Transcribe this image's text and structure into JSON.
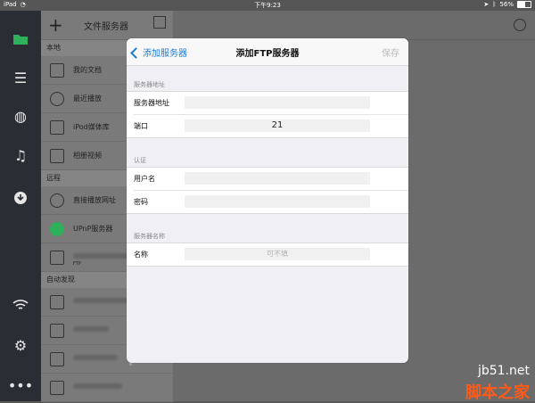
{
  "status_bar": {
    "device": "iPad",
    "time": "下午9:23",
    "battery": "56%"
  },
  "side_panel": {
    "title": "文件服务器",
    "sections": [
      {
        "label": "本地",
        "items": [
          {
            "label": "我的文档",
            "icon": "document-icon"
          },
          {
            "label": "最近播放",
            "icon": "clock-icon"
          },
          {
            "label": "iPod媒体库",
            "icon": "ipod-icon"
          },
          {
            "label": "相册视频",
            "icon": "film-icon"
          }
        ]
      },
      {
        "label": "远程",
        "items": [
          {
            "label": "直接播放网址",
            "icon": "link-icon"
          },
          {
            "label": "UPnP服务器",
            "icon": "upnp-icon"
          },
          {
            "label": "",
            "sublabel": "FTP",
            "icon": "ftp-server-icon"
          }
        ]
      },
      {
        "label": "自动发现",
        "items": []
      }
    ]
  },
  "modal": {
    "back_label": "添加服务器",
    "title": "添加FTP服务器",
    "save_label": "保存",
    "groups": [
      {
        "label": "服务器地址",
        "fields": [
          {
            "label": "服务器地址",
            "value": "",
            "placeholder": ""
          },
          {
            "label": "端口",
            "value": "21",
            "placeholder": ""
          }
        ]
      },
      {
        "label": "认证",
        "fields": [
          {
            "label": "用户名",
            "value": "",
            "placeholder": ""
          },
          {
            "label": "密码",
            "value": "",
            "placeholder": ""
          }
        ]
      },
      {
        "label": "服务器名称",
        "fields": [
          {
            "label": "名称",
            "value": "",
            "placeholder": "可不填"
          }
        ]
      }
    ]
  },
  "watermark": {
    "site": "jb51.net",
    "text": "脚本之家"
  }
}
